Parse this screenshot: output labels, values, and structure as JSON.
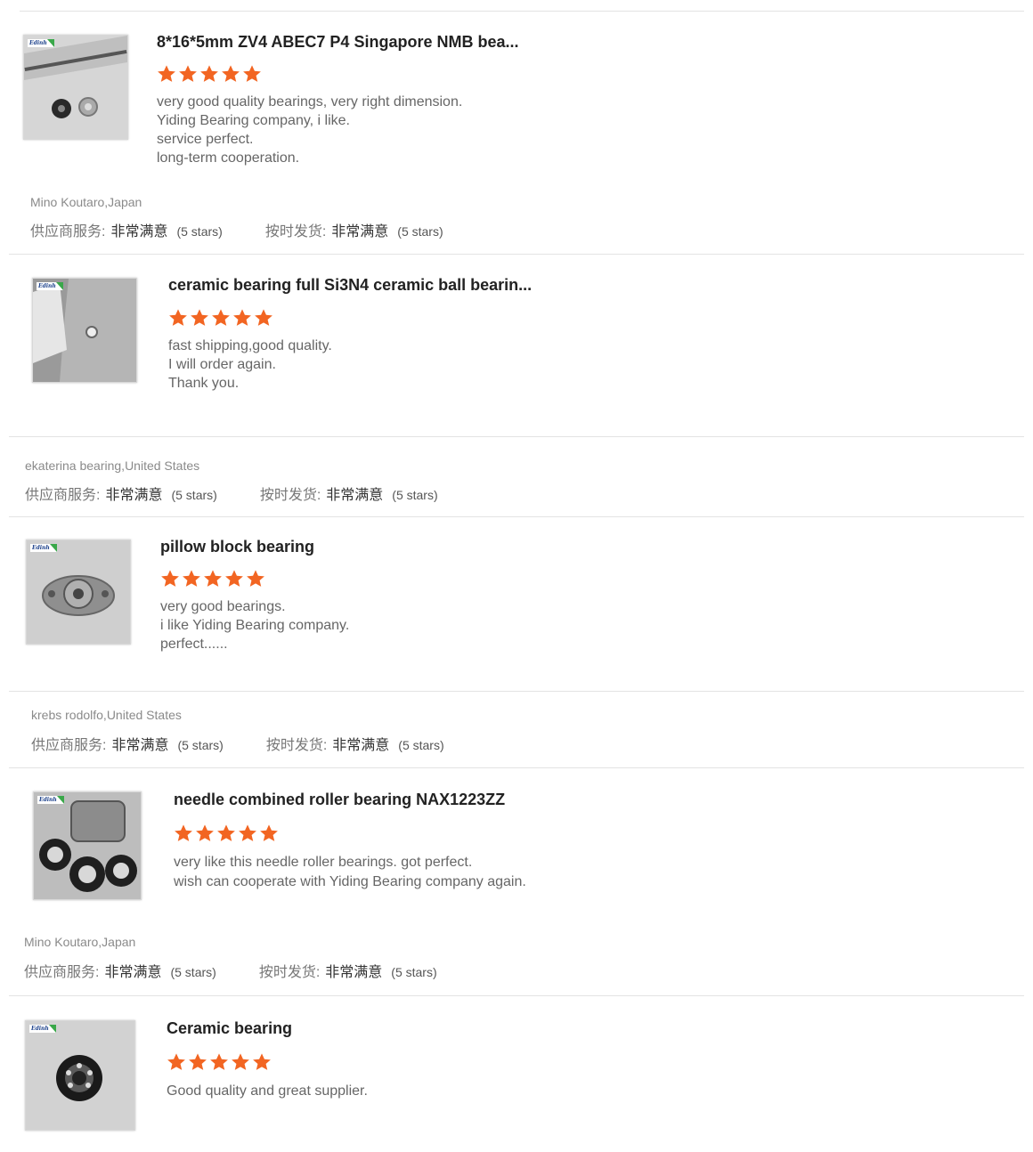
{
  "reviews": [
    {
      "title": "8*16*5mm ZV4 ABEC7 P4 Singapore NMB bea...",
      "lines": [
        "very good quality bearings, very right dimension.",
        "Yiding Bearing company, i like.",
        "service perfect.",
        "long-term cooperation."
      ],
      "author": "Mino Koutaro,Japan",
      "image_label": "Edinh",
      "rating": 5
    },
    {
      "title": "ceramic bearing full Si3N4 ceramic ball bearin...",
      "lines": [
        "fast shipping,good quality.",
        "I will order again.",
        "Thank you."
      ],
      "author": "ekaterina bearing,United States",
      "image_label": "Edinh",
      "rating": 5
    },
    {
      "title": "pillow block bearing",
      "lines": [
        "very good bearings.",
        "i like Yiding Bearing company.",
        "perfect......"
      ],
      "author": "krebs rodolfo,United States",
      "image_label": "Edinh",
      "rating": 5
    },
    {
      "title": "needle combined roller bearing NAX1223ZZ",
      "lines": [
        "very like this needle roller bearings. got perfect.",
        "wish can cooperate with Yiding Bearing company again."
      ],
      "author": "Mino Koutaro,Japan",
      "image_label": "Edinh",
      "rating": 5
    },
    {
      "title": "Ceramic bearing",
      "lines": [
        "Good quality and great supplier."
      ],
      "image_label": "Edinh",
      "rating": 5
    }
  ],
  "ratings_labels": {
    "supplier_service": "供应商服务:",
    "on_time_delivery": "按时发货:",
    "value": "非常满意",
    "count": "(5 stars)"
  },
  "colors": {
    "star": "#f26522",
    "divider": "#e3e3e3"
  }
}
